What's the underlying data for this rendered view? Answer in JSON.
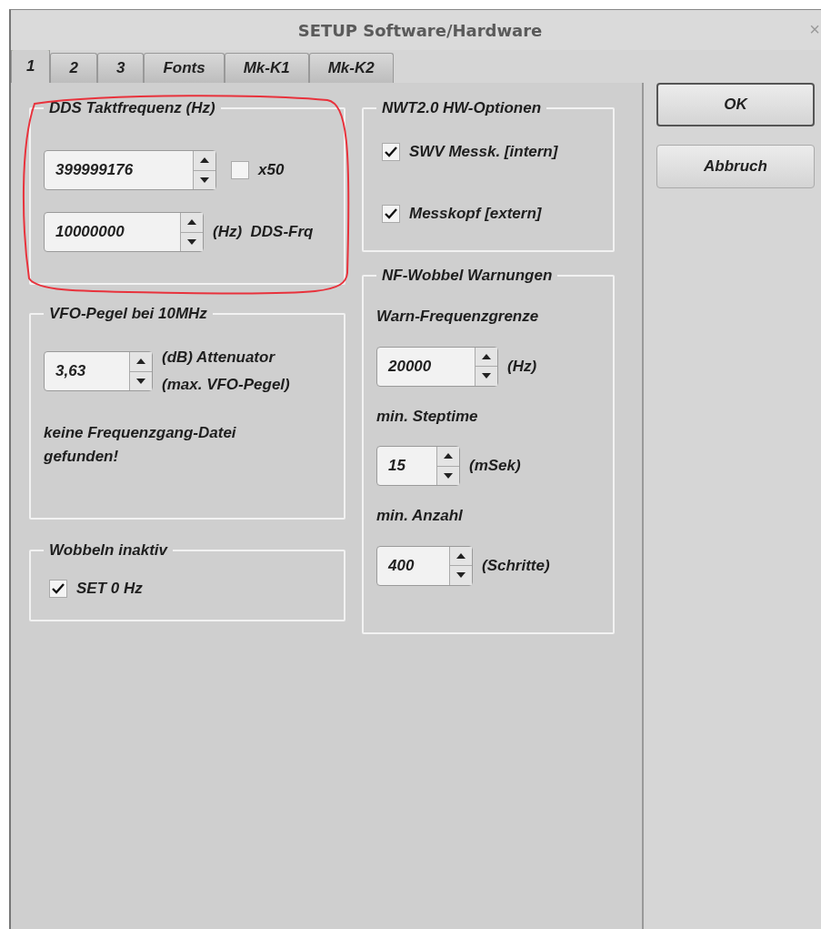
{
  "window": {
    "title": "SETUP Software/Hardware",
    "close": "×"
  },
  "tabs": [
    {
      "label": "1",
      "selected": true
    },
    {
      "label": "2",
      "selected": false
    },
    {
      "label": "3",
      "selected": false
    },
    {
      "label": "Fonts",
      "selected": false
    },
    {
      "label": "Mk-K1",
      "selected": false
    },
    {
      "label": "Mk-K2",
      "selected": false
    }
  ],
  "left_groups": [
    {
      "title": "DDS Taktfrequenz (Hz)",
      "rows": [
        [
          {
            "kind": "spin",
            "value": "399999176"
          },
          {
            "kind": "check",
            "label": "x50",
            "checked": false
          }
        ],
        [
          {
            "kind": "spin",
            "value": "10000000"
          },
          {
            "kind": "text",
            "text": "(Hz)  DDS-Frq"
          }
        ]
      ]
    },
    {
      "title": "VFO-Pegel bei 10MHz",
      "rows": [
        [
          {
            "kind": "spin",
            "value": "3,63"
          },
          {
            "kind": "lines",
            "lines": [
              "(dB) Attenuator",
              "(max. VFO-Pegel)"
            ]
          }
        ],
        [
          {
            "kind": "text",
            "text": "keine Frequenzgang-Datei gefunden!"
          }
        ]
      ]
    },
    {
      "title": "Wobbeln inaktiv",
      "rows": [
        [
          {
            "kind": "check",
            "label": "SET 0 Hz",
            "checked": true
          }
        ]
      ]
    }
  ],
  "right_groups": [
    {
      "title": "NWT2.0 HW-Optionen",
      "rows": [
        [
          {
            "kind": "check",
            "label": "SWV Messk. [intern]",
            "checked": true
          }
        ],
        [
          {
            "kind": "check",
            "label": "Messkopf [extern]",
            "checked": true
          }
        ]
      ]
    },
    {
      "title": "NF-Wobbel Warnungen",
      "rows": [
        [
          {
            "kind": "text",
            "text": "Warn-Frequenzgrenze"
          }
        ],
        [
          {
            "kind": "spin",
            "value": "20000"
          },
          {
            "kind": "text",
            "text": "(Hz)"
          }
        ],
        [
          {
            "kind": "text",
            "text": "min. Steptime"
          }
        ],
        [
          {
            "kind": "spin",
            "value": "15"
          },
          {
            "kind": "text",
            "text": "(mSek)"
          }
        ],
        [
          {
            "kind": "text",
            "text": "min. Anzahl"
          }
        ],
        [
          {
            "kind": "spin",
            "value": "400"
          },
          {
            "kind": "text",
            "text": "(Schritte)"
          }
        ]
      ]
    }
  ],
  "buttons": [
    {
      "label": "OK",
      "default": true
    },
    {
      "label": "Abbruch",
      "default": false
    }
  ]
}
